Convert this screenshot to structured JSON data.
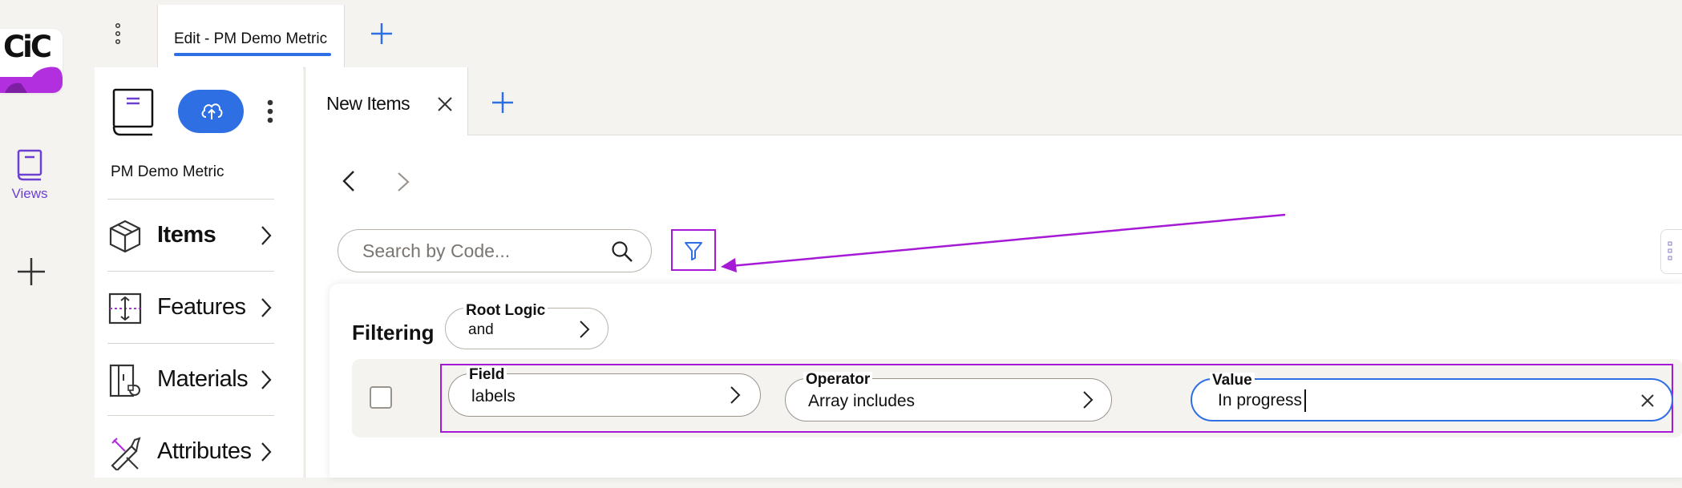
{
  "app": {
    "logo_text": "CiC",
    "rail": {
      "views_label": "Views"
    }
  },
  "topbar": {
    "tab_label": "Edit - PM Demo Metric"
  },
  "sidebar": {
    "title": "PM Demo Metric",
    "items": [
      {
        "label": "Items",
        "icon": "cube-icon",
        "active": true
      },
      {
        "label": "Features",
        "icon": "features-icon",
        "active": false
      },
      {
        "label": "Materials",
        "icon": "materials-icon",
        "active": false
      },
      {
        "label": "Attributes",
        "icon": "attributes-icon",
        "active": false
      }
    ]
  },
  "main": {
    "tab_label": "New Items",
    "search": {
      "placeholder": "Search by Code...",
      "value": ""
    },
    "filter": {
      "title": "Filtering",
      "root_logic": {
        "label": "Root Logic",
        "value": "and"
      },
      "rule": {
        "field": {
          "label": "Field",
          "value": "labels"
        },
        "operator": {
          "label": "Operator",
          "value": "Array includes"
        },
        "value": {
          "label": "Value",
          "value": "In progress"
        }
      }
    }
  },
  "colors": {
    "accent": "#2f6fe4",
    "annotation": "#a61ad6",
    "brand": "#b22fe0",
    "background": "#f5f3f0"
  }
}
